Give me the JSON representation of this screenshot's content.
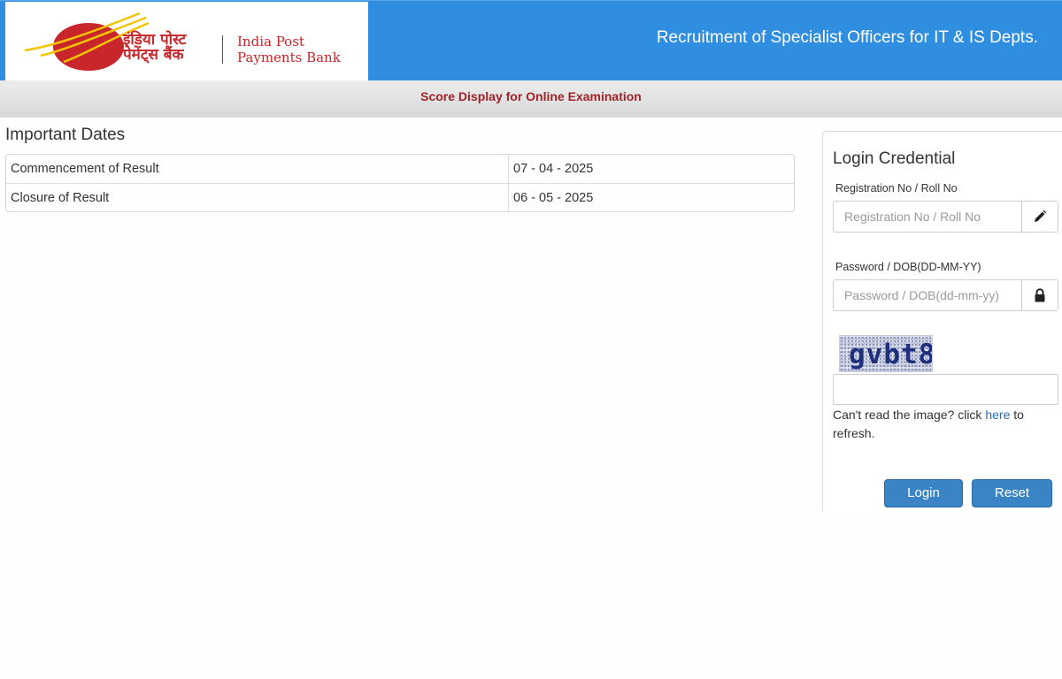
{
  "header": {
    "logo": {
      "hindi_line1": "इंडिया पोस्ट",
      "hindi_line2": "पेमेंट्स बैंक",
      "english_line1": "India Post",
      "english_line2": "Payments Bank"
    },
    "title": "Recruitment of Specialist Officers for IT & IS Depts."
  },
  "subbar": {
    "title": "Score Display for Online Examination"
  },
  "important_dates": {
    "heading": "Important Dates",
    "rows": [
      {
        "label": "Commencement of Result",
        "value": "07 - 04 - 2025"
      },
      {
        "label": "Closure of Result",
        "value": "06 - 05 - 2025"
      }
    ]
  },
  "login": {
    "heading": "Login Credential",
    "registration": {
      "label": "Registration No / Roll No",
      "placeholder": "Registration No / Roll No",
      "value": "",
      "icon": "pencil-icon"
    },
    "password": {
      "label": "Password / DOB(DD-MM-YY)",
      "placeholder": "Password / DOB(dd-mm-yy)",
      "value": "",
      "icon": "lock-icon"
    },
    "captcha": {
      "image_text": "gvbt8",
      "input_value": "",
      "help_before": "Can't read the image? click ",
      "help_link": "here",
      "help_after": " to refresh."
    },
    "buttons": {
      "login": "Login",
      "reset": "Reset"
    }
  },
  "colors": {
    "header_blue": "#2f8ee0",
    "brand_red": "#c8262a",
    "logo_yellow": "#f2c500",
    "subtitle_red": "#a0232a",
    "button_blue": "#3a83c4",
    "link_blue": "#2a6db5"
  }
}
